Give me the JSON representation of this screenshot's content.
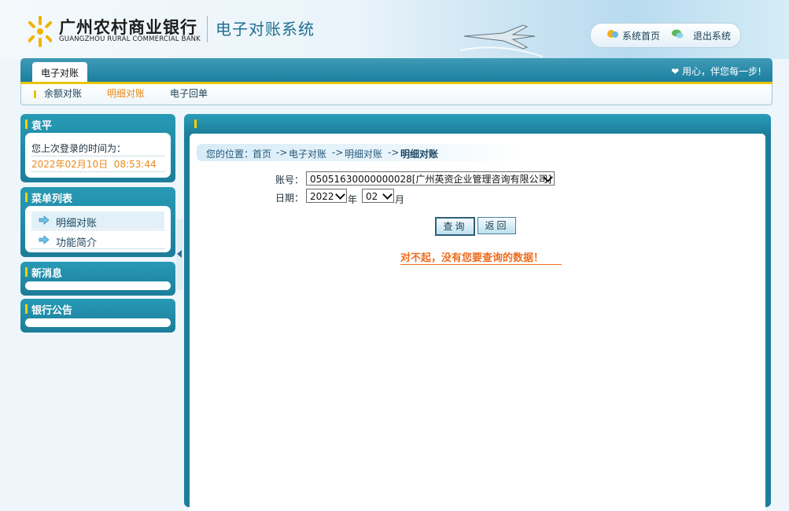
{
  "header": {
    "bank_name_cn": "广州农村商业银行",
    "bank_name_en": "GUANGZHOU RURAL COMMERCIAL BANK",
    "system_title": "电子对账系统",
    "links": {
      "home": "系统首页",
      "logout": "退出系统"
    }
  },
  "nav": {
    "active_tab": "电子对账",
    "slogan": "用心，伴您每一步",
    "sub_items": [
      "余额对账",
      "明细对账",
      "电子回单"
    ],
    "active_sub": "明细对账"
  },
  "user_panel": {
    "name": "袁平",
    "last_login_label": "您上次登录的时间为：",
    "last_login_time": "2022年02月10日  08:53:44"
  },
  "menu_panel": {
    "title": "菜单列表",
    "items": [
      "明细对账",
      "功能简介"
    ]
  },
  "news_panel": {
    "title": "新消息"
  },
  "notice_panel": {
    "title": "银行公告"
  },
  "breadcrumb": {
    "prefix": "您的位置：",
    "home": "首页",
    "sep": "->",
    "level1": "电子对账",
    "level2": "明细对账",
    "current": "明细对账"
  },
  "form": {
    "account_label": "账号：",
    "account_value": "05051630000000028[广州英资企业管理咨询有限公司]",
    "date_label": "日期：",
    "year_value": "2022",
    "year_suffix": "年",
    "month_value": "02",
    "month_suffix": "月",
    "query_button": "查询",
    "back_button": "返回"
  },
  "message": "对不起，没有您要查询的数据！",
  "colors": {
    "primary_teal": "#1d7e9b",
    "accent_yellow": "#f2d000",
    "active_orange": "#e98a1d",
    "warning_orange": "#ee6d1f"
  }
}
